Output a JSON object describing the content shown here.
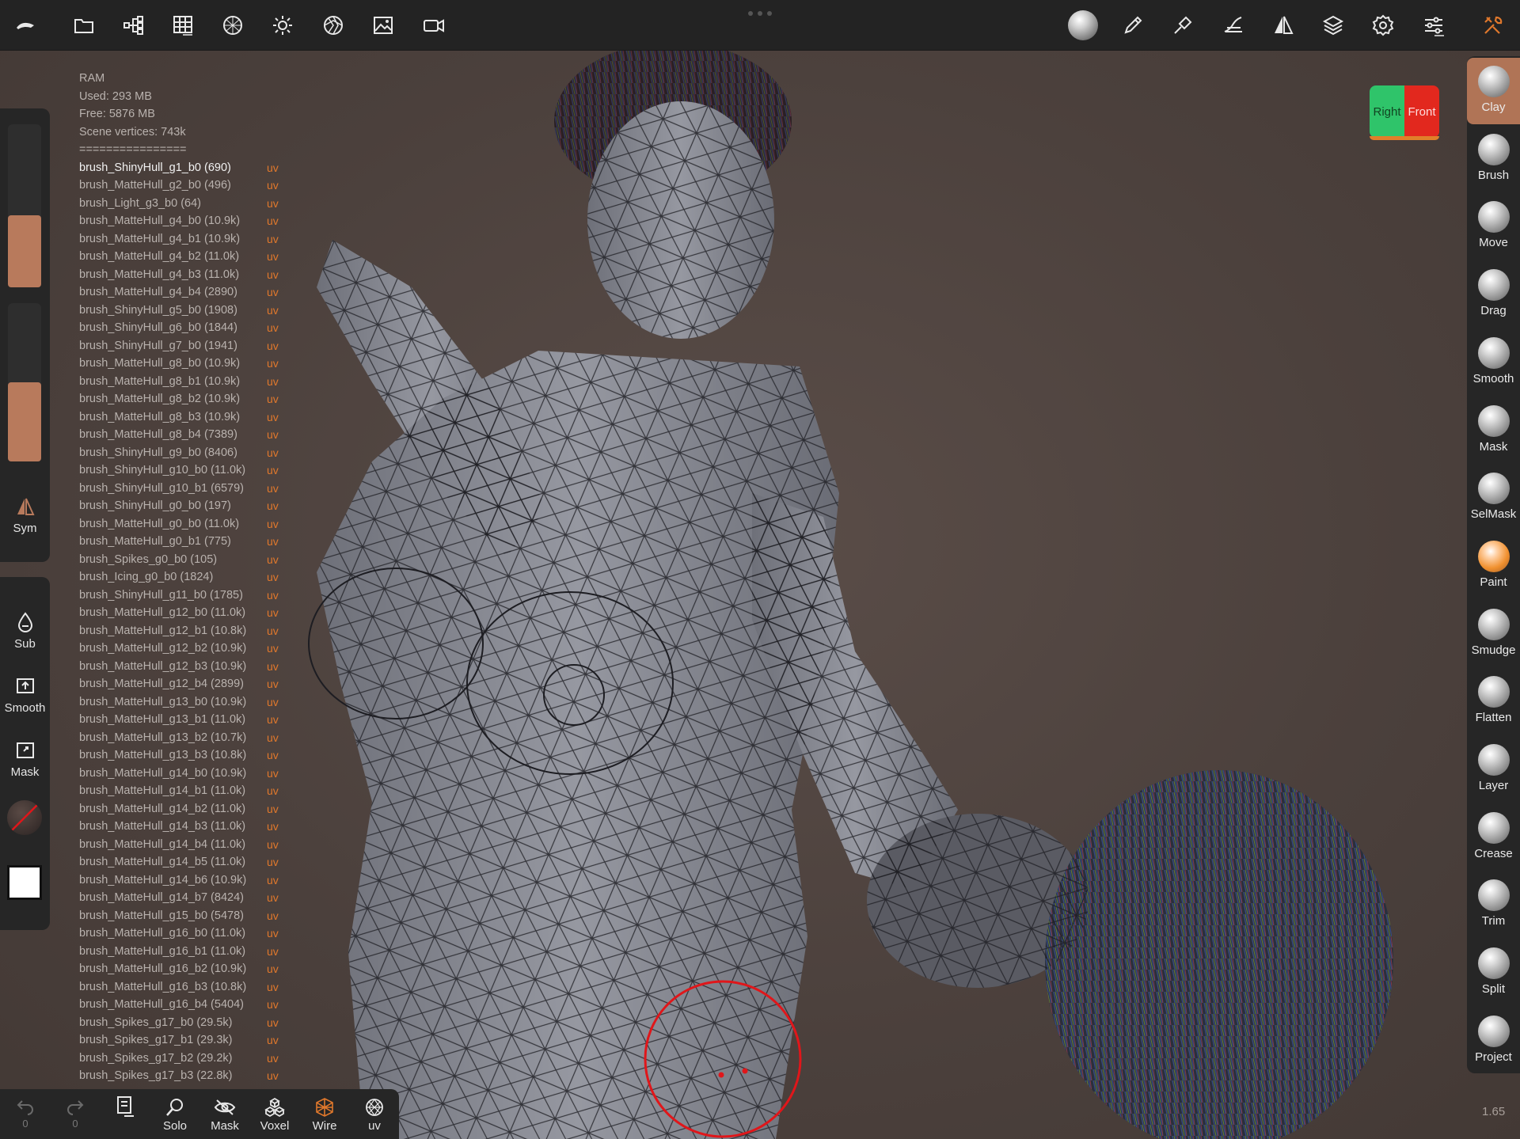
{
  "topbar": {
    "left_icons": [
      "logo-icon",
      "folder-icon",
      "scene-tree-icon",
      "grid-icon",
      "material-icon",
      "light-icon",
      "render-icon",
      "image-icon",
      "video-icon"
    ],
    "right_icons": [
      "matcap-sphere-icon",
      "pen-icon",
      "paint-tool-icon",
      "stroke-icon",
      "symmetry-icon",
      "layers-icon",
      "settings-icon",
      "sliders-icon",
      "tools-icon"
    ]
  },
  "stats": {
    "ram": "RAM",
    "used": "Used: 293 MB",
    "free": "Free: 5876 MB",
    "vertices": "Scene vertices: 743k",
    "separator": "================",
    "uv_label": "uv",
    "meshes": [
      "brush_ShinyHull_g1_b0 (690)",
      "brush_MatteHull_g2_b0 (496)",
      "brush_Light_g3_b0 (64)",
      "brush_MatteHull_g4_b0 (10.9k)",
      "brush_MatteHull_g4_b1 (10.9k)",
      "brush_MatteHull_g4_b2 (11.0k)",
      "brush_MatteHull_g4_b3 (11.0k)",
      "brush_MatteHull_g4_b4 (2890)",
      "brush_ShinyHull_g5_b0 (1908)",
      "brush_ShinyHull_g6_b0 (1844)",
      "brush_ShinyHull_g7_b0 (1941)",
      "brush_MatteHull_g8_b0 (10.9k)",
      "brush_MatteHull_g8_b1 (10.9k)",
      "brush_MatteHull_g8_b2 (10.9k)",
      "brush_MatteHull_g8_b3 (10.9k)",
      "brush_MatteHull_g8_b4 (7389)",
      "brush_ShinyHull_g9_b0 (8406)",
      "brush_ShinyHull_g10_b0 (11.0k)",
      "brush_ShinyHull_g10_b1 (6579)",
      "brush_ShinyHull_g0_b0 (197)",
      "brush_MatteHull_g0_b0 (11.0k)",
      "brush_MatteHull_g0_b1 (775)",
      "brush_Spikes_g0_b0 (105)",
      "brush_Icing_g0_b0 (1824)",
      "brush_ShinyHull_g11_b0 (1785)",
      "brush_MatteHull_g12_b0 (11.0k)",
      "brush_MatteHull_g12_b1 (10.8k)",
      "brush_MatteHull_g12_b2 (10.9k)",
      "brush_MatteHull_g12_b3 (10.9k)",
      "brush_MatteHull_g12_b4 (2899)",
      "brush_MatteHull_g13_b0 (10.9k)",
      "brush_MatteHull_g13_b1 (11.0k)",
      "brush_MatteHull_g13_b2 (10.7k)",
      "brush_MatteHull_g13_b3 (10.8k)",
      "brush_MatteHull_g14_b0 (10.9k)",
      "brush_MatteHull_g14_b1 (11.0k)",
      "brush_MatteHull_g14_b2 (11.0k)",
      "brush_MatteHull_g14_b3 (11.0k)",
      "brush_MatteHull_g14_b4 (11.0k)",
      "brush_MatteHull_g14_b5 (11.0k)",
      "brush_MatteHull_g14_b6 (10.9k)",
      "brush_MatteHull_g14_b7 (8424)",
      "brush_MatteHull_g15_b0 (5478)",
      "brush_MatteHull_g16_b0 (11.0k)",
      "brush_MatteHull_g16_b1 (11.0k)",
      "brush_MatteHull_g16_b2 (10.9k)",
      "brush_MatteHull_g16_b3 (10.8k)",
      "brush_MatteHull_g16_b4 (5404)",
      "brush_Spikes_g17_b0 (29.5k)",
      "brush_Spikes_g17_b1 (29.3k)",
      "brush_Spikes_g17_b2 (29.2k)",
      "brush_Spikes_g17_b3 (22.8k)"
    ]
  },
  "left_panel": {
    "slider_radius_value": 0.44,
    "slider_intensity_value": 0.5,
    "sym_label": "Sym",
    "sub_label": "Sub",
    "smooth_label": "Smooth",
    "mask_label": "Mask"
  },
  "brushes": {
    "active": "Clay",
    "items": [
      "Clay",
      "Brush",
      "Move",
      "Drag",
      "Smooth",
      "Mask",
      "SelMask",
      "Paint",
      "Smudge",
      "Flatten",
      "Layer",
      "Crease",
      "Trim",
      "Split",
      "Project"
    ]
  },
  "gizmo": {
    "right": "Right",
    "front": "Front",
    "right_color": "#2fc46a",
    "front_color": "#e2281e"
  },
  "bottombar": {
    "undo_count": "0",
    "redo_count": "0",
    "solo": "Solo",
    "mask": "Mask",
    "voxel": "Voxel",
    "wire": "Wire",
    "uv": "uv",
    "wire_active_color": "#e0782c"
  },
  "zoom": "1.65",
  "colors": {
    "accent": "#b87a5c",
    "uv": "#e0782c",
    "cursor": "#e0161a"
  }
}
